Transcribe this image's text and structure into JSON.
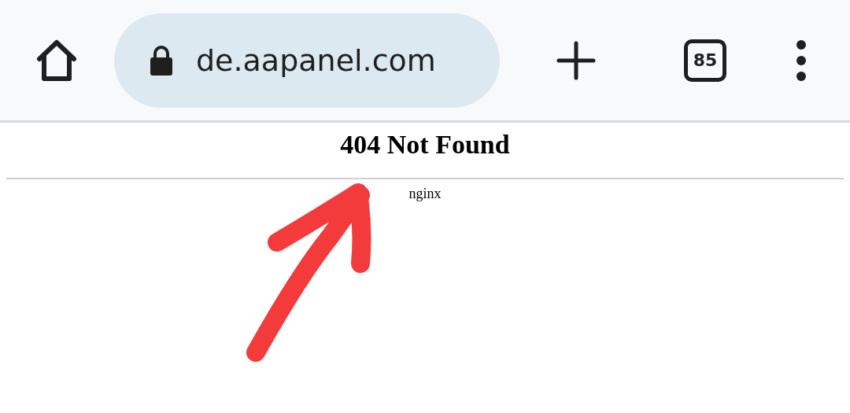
{
  "toolbar": {
    "url": "de.aapanel.com",
    "tab_count": "85"
  },
  "page": {
    "heading": "404 Not Found",
    "server": "nginx"
  }
}
